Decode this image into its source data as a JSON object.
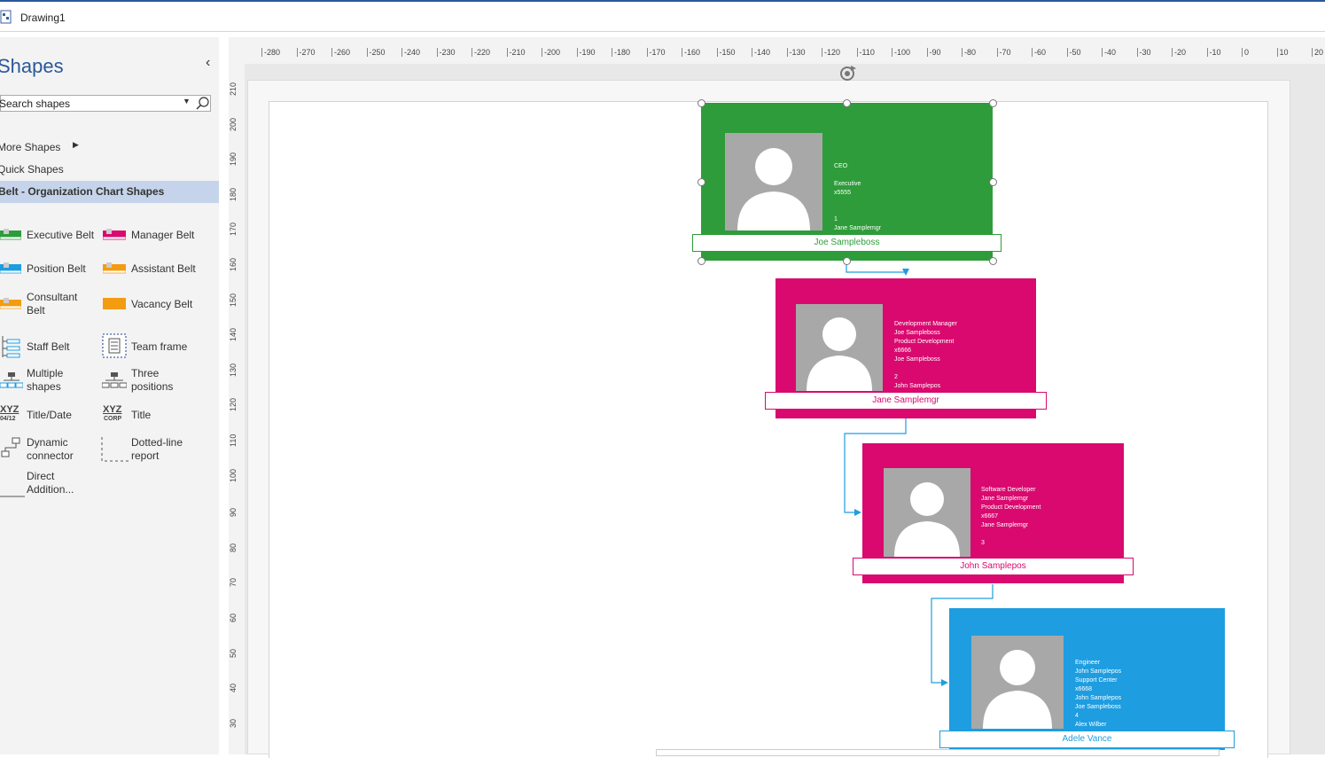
{
  "window": {
    "title": "Drawing1"
  },
  "shapes_pane": {
    "title": "Shapes",
    "collapse_glyph": "‹",
    "search_placeholder": "Search shapes",
    "more_shapes": "More Shapes",
    "quick_shapes": "Quick Shapes",
    "selected_stencil": "Belt - Organization Chart Shapes",
    "stencil_items": [
      {
        "label": "Executive Belt",
        "icon": "executive-belt-icon"
      },
      {
        "label": "Manager Belt",
        "icon": "manager-belt-icon"
      },
      {
        "label": "Position Belt",
        "icon": "position-belt-icon"
      },
      {
        "label": "Assistant Belt",
        "icon": "assistant-belt-icon"
      },
      {
        "label": "Consultant Belt",
        "icon": "consultant-belt-icon"
      },
      {
        "label": "Vacancy Belt",
        "icon": "vacancy-belt-icon"
      },
      {
        "label": "Staff Belt",
        "icon": "staff-belt-icon"
      },
      {
        "label": "Team frame",
        "icon": "team-frame-icon"
      },
      {
        "label": "Multiple shapes",
        "icon": "multiple-shapes-icon"
      },
      {
        "label": "Three positions",
        "icon": "three-positions-icon"
      },
      {
        "label": "Title/Date",
        "icon": "title-date-icon"
      },
      {
        "label": "Title",
        "icon": "title-icon"
      },
      {
        "label": "Dynamic connector",
        "icon": "dynamic-connector-icon"
      },
      {
        "label": "Dotted-line report",
        "icon": "dotted-line-report-icon"
      },
      {
        "label": "Direct Addition...",
        "icon": "direct-addition-icon"
      }
    ],
    "icon_text": {
      "xyz": "XYZ",
      "date": "04/12",
      "corp": "CORP"
    }
  },
  "ruler": {
    "horizontal": [
      "-280",
      "-270",
      "-260",
      "-250",
      "-240",
      "-230",
      "-220",
      "-210",
      "-200",
      "-190",
      "-180",
      "-170",
      "-160",
      "-150",
      "-140",
      "-130",
      "-120",
      "-110",
      "-100",
      "-90",
      "-80",
      "-70",
      "-60",
      "-50",
      "-40",
      "-30",
      "-20",
      "-10",
      "0",
      "10",
      "20"
    ],
    "vertical": [
      "210",
      "200",
      "190",
      "180",
      "170",
      "160",
      "150",
      "140",
      "130",
      "120",
      "110",
      "100",
      "90",
      "80",
      "70",
      "60",
      "50",
      "40",
      "30"
    ]
  },
  "org_chart": {
    "colors": {
      "executive": "#2e9c3a",
      "manager": "#d9096f",
      "position": "#1e9de0",
      "connector": "#1e9de0"
    },
    "cards": [
      {
        "name": "Joe Sampleboss",
        "info": [
          "CEO",
          "",
          "Executive",
          "x5555",
          "",
          "",
          "1",
          "Jane Samplemgr"
        ],
        "type": "executive"
      },
      {
        "name": "Jane Samplemgr",
        "info": [
          "Development Manager",
          "Joe Sampleboss",
          "Product Development",
          "x6666",
          "Joe Sampleboss",
          "",
          "2",
          "John Samplepos"
        ],
        "type": "manager"
      },
      {
        "name": "John Samplepos",
        "info": [
          "Software Developer",
          "Jane Samplemgr",
          "Product Development",
          "x6667",
          "Jane Samplemgr",
          "",
          "3"
        ],
        "type": "manager"
      },
      {
        "name": "Adele Vance",
        "info": [
          "Engineer",
          "John Samplepos",
          "Support Center",
          "x6668",
          "John Samplepos",
          "Joe Sampleboss",
          "4",
          "Alex Wilber"
        ],
        "type": "position"
      }
    ]
  }
}
